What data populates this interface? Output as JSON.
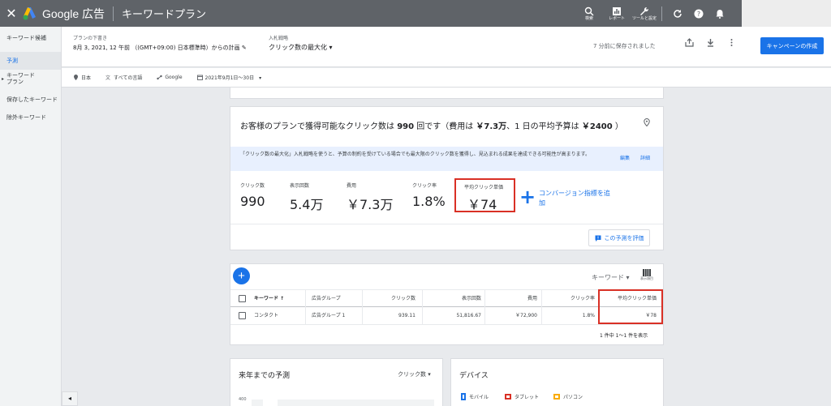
{
  "topbar": {
    "close": "✕",
    "brand": "Google 広告",
    "page_title": "キーワードプラン",
    "tools": [
      {
        "icon": "search-icon",
        "label": "検索"
      },
      {
        "icon": "report-icon",
        "label": "レポート"
      },
      {
        "icon": "wrench-icon",
        "label": "ツールと設定"
      }
    ],
    "right_icons": [
      "refresh-icon",
      "help-icon",
      "bell-icon"
    ]
  },
  "sidebar": {
    "items": [
      {
        "label": "キーワード候補",
        "active": false
      },
      {
        "label": "予測",
        "active": true
      },
      {
        "label": "キーワードプラン",
        "active": false
      },
      {
        "label": "保存したキーワード",
        "active": false
      },
      {
        "label": "除外キーワード",
        "active": false
      }
    ],
    "collapse_icon": "◂"
  },
  "header": {
    "plan_label": "プランの下書き",
    "plan_value": "8月 3, 2021, 12 午前 （(GMT+09:00) 日本標準時）からの計画 ✎",
    "bid_label": "入札戦略",
    "bid_value": "クリック数の最大化 ▾",
    "saved": "7 分前に保存されました",
    "create_button": "キャンペーンの作成",
    "filters": [
      {
        "icon": "location-icon",
        "label": "日本"
      },
      {
        "icon": "translate-icon",
        "label": "すべての言語"
      },
      {
        "icon": "network-icon",
        "label": "Google"
      },
      {
        "icon": "calendar-icon",
        "label": "2021年9月1日〜30日　▾"
      }
    ]
  },
  "forecast": {
    "title_pre": "お客様のプランで獲得可能なクリック数は ",
    "title_clicks": "990",
    "title_mid": " 回です（費用は ",
    "title_cost": "￥7.3万",
    "title_mid2": "、1 日の平均予算は ",
    "title_daily": "￥2400",
    "title_post": " ）",
    "note": "「クリック数の最大化」入札戦略を使うと、予算の制約を受けている場合でも最大限のクリック数を獲得し、見込まれる成果を達成できる可能性が高まります。",
    "note_edit": "編集",
    "note_detail": "詳細",
    "metrics": [
      {
        "label": "クリック数",
        "value": "990"
      },
      {
        "label": "表示回数",
        "value": "5.4万"
      },
      {
        "label": "費用",
        "value": "￥7.3万"
      },
      {
        "label": "クリック率",
        "value": "1.8%"
      }
    ],
    "cpc": {
      "label": "平均クリック単価",
      "value": "￥74"
    },
    "add_conversion": "コンバージョン指標を追加",
    "rate_button": "この予測を評価"
  },
  "table": {
    "add": "+",
    "keyword_select": "キーワード ▾",
    "columns_label": "表示項目",
    "headers": {
      "keyword": "キーワード ↑",
      "ad_group": "広告グループ",
      "clicks": "クリック数",
      "impressions": "表示回数",
      "cost": "費用",
      "ctr": "クリック率",
      "cpc": "平均クリック単価"
    },
    "row": {
      "keyword": "コンタクト",
      "ad_group": "広告グループ 1",
      "clicks": "939.11",
      "impressions": "51,816.67",
      "cost": "￥72,900",
      "ctr": "1.8%",
      "cpc": "￥78"
    },
    "pager": "1 件中 1〜1 件を表示"
  },
  "annual": {
    "title": "来年までの予測",
    "select": "クリック数 ▾",
    "axis_top": "400"
  },
  "device": {
    "title": "デバイス",
    "legend": [
      {
        "label": "モバイル",
        "color": "#1a73e8"
      },
      {
        "label": "タブレット",
        "color": "#d93025"
      },
      {
        "label": "パソコン",
        "color": "#f9ab00"
      }
    ]
  }
}
